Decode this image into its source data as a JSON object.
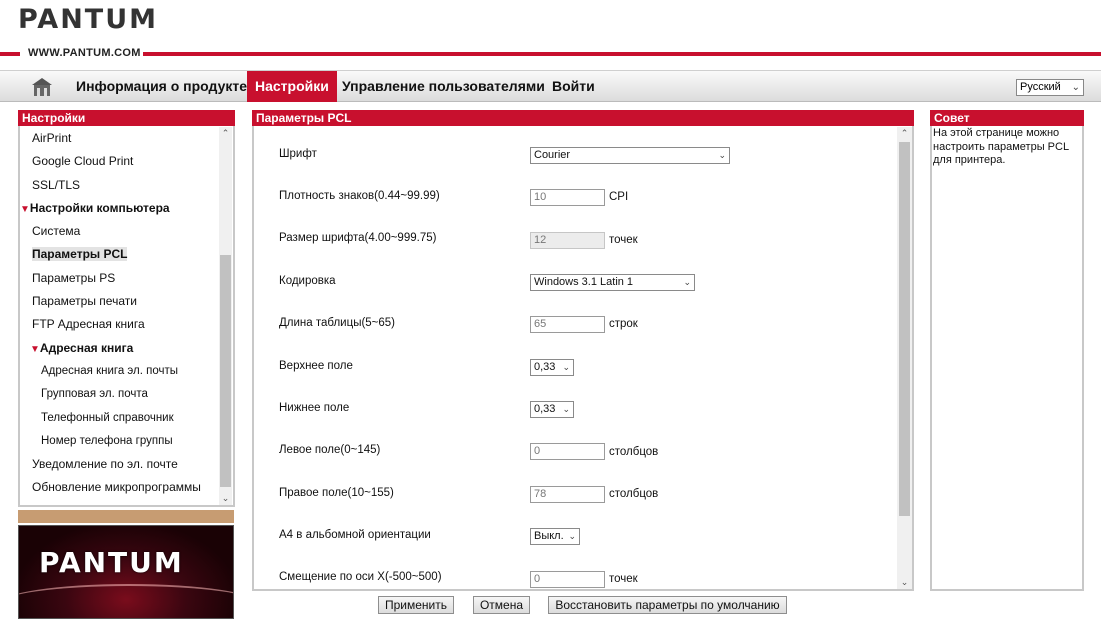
{
  "brand": {
    "logo_text": "PANTUM",
    "url": "WWW.PANTUM.COM"
  },
  "nav": {
    "items": [
      {
        "label": "Информация о продукте"
      },
      {
        "label": "Настройки"
      },
      {
        "label": "Управление пользователями"
      },
      {
        "label": "Войти"
      }
    ],
    "language": "Русский"
  },
  "sidebar": {
    "title": "Настройки",
    "items": [
      {
        "label": "AirPrint"
      },
      {
        "label": "Google Cloud Print"
      },
      {
        "label": "SSL/TLS"
      },
      {
        "label": "Настройки компьютера"
      },
      {
        "label": "Система"
      },
      {
        "label": "Параметры PCL"
      },
      {
        "label": "Параметры PS"
      },
      {
        "label": "Параметры печати"
      },
      {
        "label": "FTP Адресная книга"
      },
      {
        "label": "Адресная книга"
      },
      {
        "label": "Адресная книга эл. почты"
      },
      {
        "label": "Групповая эл. почта"
      },
      {
        "label": "Телефонный справочник"
      },
      {
        "label": "Номер телефона группы"
      },
      {
        "label": "Уведомление по эл. почте"
      },
      {
        "label": "Обновление микропрограммы"
      }
    ]
  },
  "main": {
    "title": "Параметры PCL",
    "fields": [
      {
        "label": "Шрифт",
        "value": "Courier"
      },
      {
        "label": "Плотность знаков(0.44~99.99)",
        "value": "10",
        "unit": "CPI"
      },
      {
        "label": "Размер шрифта(4.00~999.75)",
        "value": "12",
        "unit": "точек"
      },
      {
        "label": "Кодировка",
        "value": "Windows 3.1 Latin 1"
      },
      {
        "label": "Длина таблицы(5~65)",
        "value": "65",
        "unit": "строк"
      },
      {
        "label": "Верхнее поле",
        "value": "0,33"
      },
      {
        "label": "Нижнее поле",
        "value": "0,33"
      },
      {
        "label": "Левое поле(0~145)",
        "value": "0",
        "unit": "столбцов"
      },
      {
        "label": "Правое поле(10~155)",
        "value": "78",
        "unit": "столбцов"
      },
      {
        "label": "A4 в альбомной ориентации",
        "value": "Выкл."
      },
      {
        "label": "Смещение по оси X(-500~500)",
        "value": "0",
        "unit": "точек"
      }
    ],
    "buttons": {
      "apply": "Применить",
      "cancel": "Отмена",
      "restore": "Восстановить параметры по умолчанию"
    }
  },
  "tip": {
    "title": "Совет",
    "text": "На этой странице можно настроить параметры PCL для принтера."
  },
  "colors": {
    "accent": "#c8102e",
    "tan": "#c79c72"
  }
}
